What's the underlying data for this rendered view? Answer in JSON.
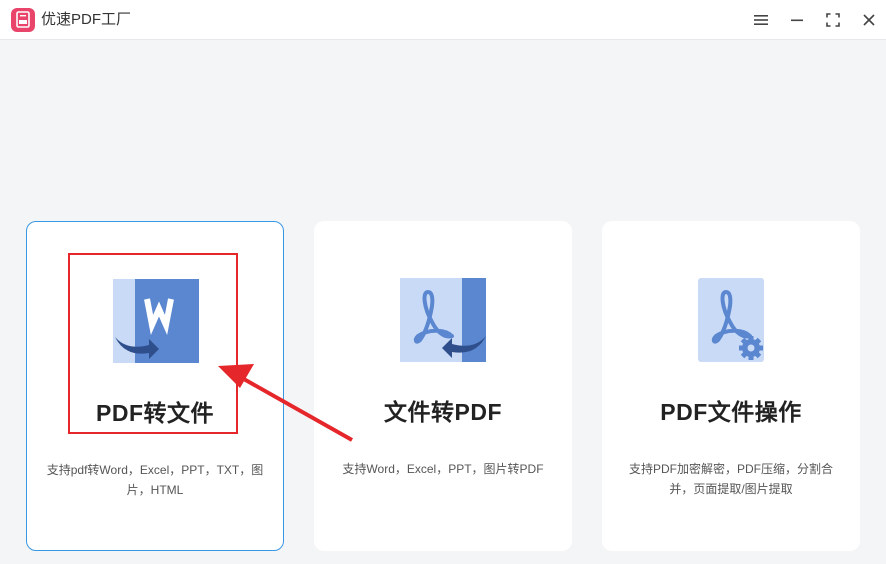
{
  "window": {
    "title": "优速PDF工厂",
    "controls": [
      "menu-icon",
      "minimize-icon",
      "maximize-icon",
      "close-icon"
    ]
  },
  "cards": [
    {
      "title": "PDF转文件",
      "description": "支持pdf转Word，Excel，PPT，TXT，图片，HTML",
      "icon": "pdf-to-word-icon",
      "selected": true
    },
    {
      "title": "文件转PDF",
      "description": "支持Word，Excel，PPT，图片转PDF",
      "icon": "file-to-pdf-icon",
      "selected": false
    },
    {
      "title": "PDF文件操作",
      "description": "支持PDF加密解密，PDF压缩，分割合并，页面提取/图片提取",
      "icon": "pdf-tools-icon",
      "selected": false
    }
  ],
  "annotation": {
    "highlight_color": "#e5262a"
  },
  "colors": {
    "accent": "#3a97e5",
    "icon_blue": "#5b87d0",
    "icon_light": "#c9daf6",
    "logo": "#e9456b"
  }
}
